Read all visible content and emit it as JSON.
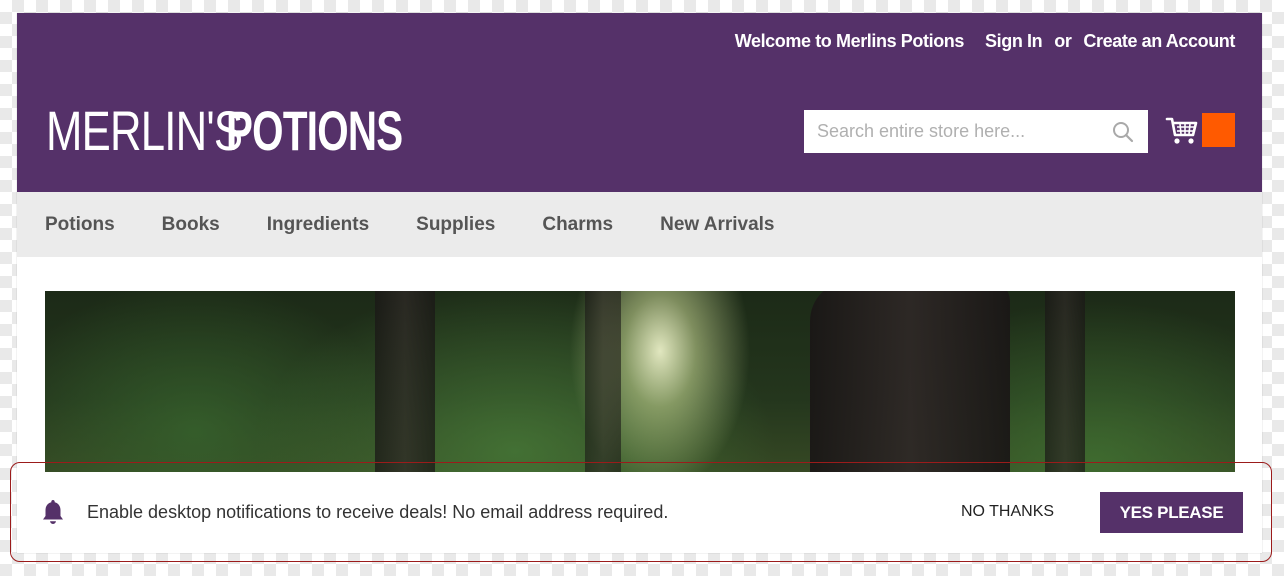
{
  "header": {
    "welcome": "Welcome to Merlins Potions",
    "sign_in": "Sign In",
    "or": "or",
    "create_account": "Create an Account",
    "logo_light": "MERLIN'S",
    "logo_bold": "POTIONS",
    "search_placeholder": "Search entire store here...",
    "search_icon": "search-icon",
    "cart_icon": "shopping-cart-icon",
    "cart_badge_color": "#ff5a00",
    "brand_color": "#553169"
  },
  "nav": {
    "items": [
      {
        "label": "Potions"
      },
      {
        "label": "Books"
      },
      {
        "label": "Ingredients"
      },
      {
        "label": "Supplies"
      },
      {
        "label": "Charms"
      },
      {
        "label": "New Arrivals"
      }
    ]
  },
  "notification": {
    "icon": "bell-icon",
    "message": "Enable desktop notifications to receive deals! No email address required.",
    "no_thanks": "NO THANKS",
    "yes_please": "YES PLEASE"
  }
}
